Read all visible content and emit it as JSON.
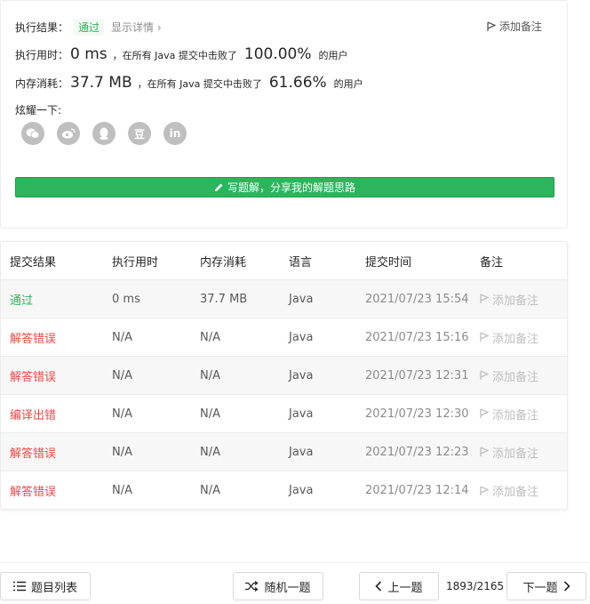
{
  "result": {
    "status_label": "执行结果：",
    "status_badge": "通过",
    "detail_link": "显示详情 ›",
    "add_note": "添加备注",
    "time_label": "执行用时：",
    "time_value": "0 ms",
    "beat_text": "，在所有 Java 提交中击败了",
    "time_pct": "100.00%",
    "users_text": "的用户",
    "mem_label": "内存消耗：",
    "mem_value": "37.7 MB",
    "mem_pct": "61.66%",
    "share_label": "炫耀一下:",
    "share_icons": [
      "wechat-icon",
      "weibo-icon",
      "qq-icon",
      "douban-icon",
      "linkedin-icon"
    ],
    "douban_glyph": "豆",
    "linkedin_glyph": "in",
    "write_button": "写题解，分享我的解题思路"
  },
  "submissions": {
    "headers": [
      "提交结果",
      "执行用时",
      "内存消耗",
      "语言",
      "提交时间",
      "备注"
    ],
    "rows": [
      {
        "status": "通过",
        "type": "pass",
        "time": "0 ms",
        "memory": "37.7 MB",
        "lang": "Java",
        "submitted": "2021/07/23 15:54",
        "note": "添加备注"
      },
      {
        "status": "解答错误",
        "type": "fail",
        "time": "N/A",
        "memory": "N/A",
        "lang": "Java",
        "submitted": "2021/07/23 15:16",
        "note": "添加备注"
      },
      {
        "status": "解答错误",
        "type": "fail",
        "time": "N/A",
        "memory": "N/A",
        "lang": "Java",
        "submitted": "2021/07/23 12:31",
        "note": "添加备注"
      },
      {
        "status": "编译出错",
        "type": "fail",
        "time": "N/A",
        "memory": "N/A",
        "lang": "Java",
        "submitted": "2021/07/23 12:30",
        "note": "添加备注"
      },
      {
        "status": "解答错误",
        "type": "fail",
        "time": "N/A",
        "memory": "N/A",
        "lang": "Java",
        "submitted": "2021/07/23 12:23",
        "note": "添加备注"
      },
      {
        "status": "解答错误",
        "type": "fail",
        "time": "N/A",
        "memory": "N/A",
        "lang": "Java",
        "submitted": "2021/07/23 12:14",
        "note": "添加备注"
      }
    ]
  },
  "footer": {
    "list_button": "题目列表",
    "random_button": "随机一题",
    "prev_button": "上一题",
    "pager": "1893/2165",
    "next_button": "下一题"
  },
  "colors": {
    "accent_green": "#2db55d",
    "error_red": "#ef4743"
  }
}
